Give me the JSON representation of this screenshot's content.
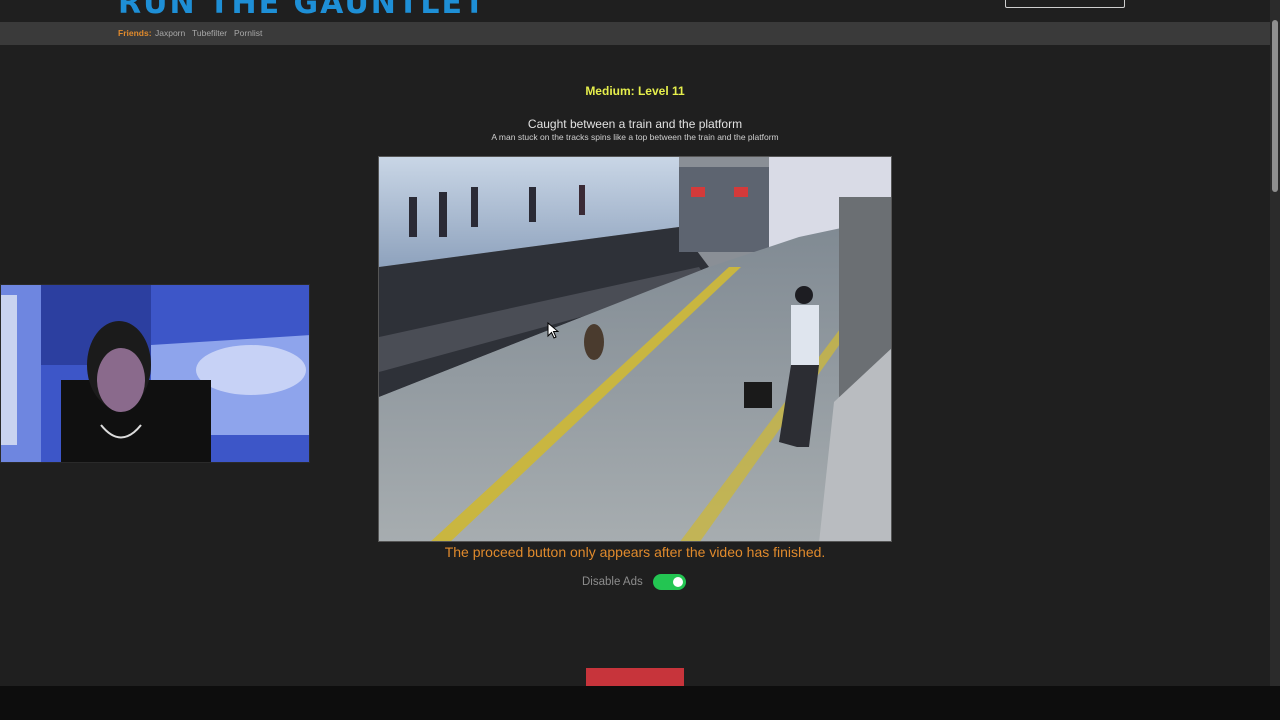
{
  "header": {
    "logo_text": "RUN THE GAUNTLET"
  },
  "friends": {
    "label": "Friends:",
    "links": [
      "Jaxporn",
      "Tubefilter",
      "Pornlist"
    ]
  },
  "level": {
    "title": "Medium: Level 11"
  },
  "video": {
    "title": "Caught between a train and the platform",
    "description": "A man stuck on the tracks spins like a top between the train and the platform"
  },
  "notice": {
    "proceed_text": "The proceed button only appears after the video has finished."
  },
  "ads": {
    "label": "Disable Ads",
    "enabled": true
  },
  "colors": {
    "accent_orange": "#e08a2c",
    "level_yellow": "#e6ef4c",
    "toggle_green": "#23c552",
    "button_red": "#c7343b",
    "logo_blue": "#1e8fd6"
  }
}
